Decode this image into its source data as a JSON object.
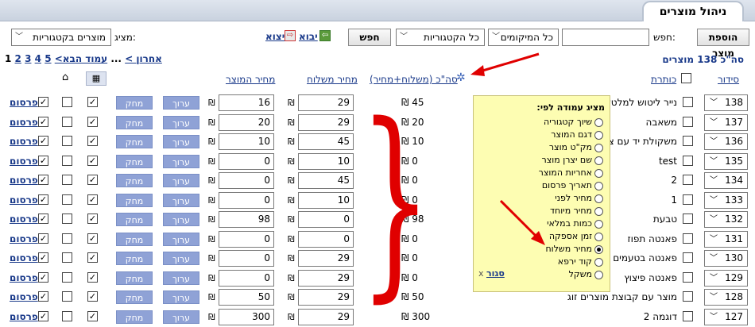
{
  "header": {
    "title": "ניהול מוצרים"
  },
  "toolbar": {
    "add_product": "הוספת מוצר",
    "search_label": "חפש:",
    "search_value": "",
    "locations_select": "כל המיקומים",
    "categories_select": "כל הקטגוריות",
    "search_button": "חפש",
    "import_label": "יבוא",
    "export_label": "יצוא",
    "display_label": "מציג:",
    "display_select": "מוצרים בקטגוריות"
  },
  "summary": {
    "total": "סה\"כ 138 מוצרים"
  },
  "pagination": {
    "current": "1",
    "pages": [
      "2",
      "3",
      "4",
      "5"
    ],
    "next": "עמוד הבא>",
    "ellipsis": "...",
    "last": "אחרון >"
  },
  "columns": {
    "order": "סידור",
    "title": "כותרת",
    "total": "סה\"כ (משלוח+מחיר)",
    "shipping": "מחיר משלוח",
    "price": "מחיר המוצר"
  },
  "currency": "₪",
  "actions": {
    "edit": "ערוך",
    "delete": "מחק",
    "publish": "פרסום"
  },
  "rows": [
    {
      "order": "138",
      "title": "נייר ליטוש למלטשה",
      "total": "45",
      "shipping": "29",
      "price": "16",
      "checked": false
    },
    {
      "order": "137",
      "title": "משאבה",
      "total": "20",
      "shipping": "29",
      "price": "20",
      "checked": false
    },
    {
      "order": "136",
      "title": "משקולת יד עם ציפוי",
      "total": "10",
      "shipping": "45",
      "price": "10",
      "checked": false
    },
    {
      "order": "135",
      "title": "test",
      "total": "0",
      "shipping": "10",
      "price": "0",
      "checked": false
    },
    {
      "order": "134",
      "title": "2",
      "total": "0",
      "shipping": "45",
      "price": "0",
      "checked": false
    },
    {
      "order": "133",
      "title": "1",
      "total": "0",
      "shipping": "10",
      "price": "0",
      "checked": false
    },
    {
      "order": "132",
      "title": "טבעת",
      "total": "98",
      "shipping": "0",
      "price": "98",
      "checked": false
    },
    {
      "order": "131",
      "title": "פאנטה תפוז",
      "total": "0",
      "shipping": "0",
      "price": "0",
      "checked": false
    },
    {
      "order": "130",
      "title": "פאנטה בטעמים",
      "total": "0",
      "shipping": "29",
      "price": "0",
      "checked": false
    },
    {
      "order": "129",
      "title": "פאנטה פיצוץ",
      "total": "0",
      "shipping": "29",
      "price": "0",
      "checked": false
    },
    {
      "order": "128",
      "title": "מוצר עם קבוצת מוצרים זוג",
      "total": "50",
      "shipping": "29",
      "price": "50",
      "checked": false
    },
    {
      "order": "127",
      "title": "דוגמה 2",
      "total": "300",
      "shipping": "29",
      "price": "300",
      "checked": false
    }
  ],
  "popup": {
    "title": "מציג עמודה לפי:",
    "options": [
      "שיוך קטגוריה",
      "דגם המוצר",
      "מק\"ט מוצר",
      "שם יצרן מוצר",
      "אחריות המוצר",
      "תאריך פרסום",
      "מחיר לפני",
      "מחיר מיוחד",
      "כמות במלאי",
      "זמן אספקה",
      "מחיר משלוח",
      "קוד ירפא",
      "משקל"
    ],
    "selected_index": 10,
    "close": "סגור",
    "close_x": "x"
  },
  "accent_color": "#e00000"
}
